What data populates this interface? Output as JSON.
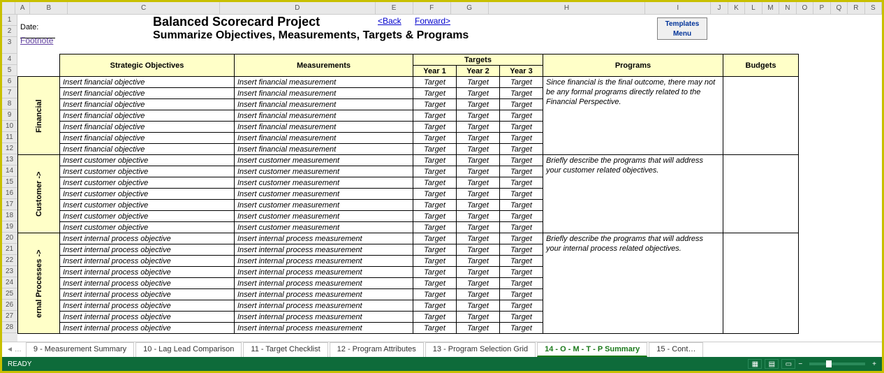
{
  "columns": [
    "A",
    "B",
    "C",
    "D",
    "E",
    "F",
    "G",
    "H",
    "I",
    "J",
    "K",
    "L",
    "M",
    "N",
    "O",
    "P",
    "Q",
    "R",
    "S"
  ],
  "rows": [
    "1",
    "2",
    "3",
    "4",
    "5",
    "6",
    "7",
    "8",
    "9",
    "10",
    "11",
    "12",
    "13",
    "14",
    "15",
    "16",
    "17",
    "18",
    "19",
    "20",
    "21",
    "22",
    "23",
    "24",
    "25",
    "26",
    "27",
    "28"
  ],
  "header": {
    "date_label": "Date:",
    "title1": "Balanced Scorecard Project",
    "title2": "Summarize Objectives, Measurements, Targets & Programs",
    "back": "<Back",
    "forward": "Forward>",
    "footnote": "Footnote",
    "templates_menu": "Templates Menu"
  },
  "table": {
    "hdr_objectives": "Strategic Objectives",
    "hdr_measurements": "Measurements",
    "hdr_targets": "Targets",
    "hdr_y1": "Year 1",
    "hdr_y2": "Year 2",
    "hdr_y3": "Year 3",
    "hdr_programs": "Programs",
    "hdr_budgets": "Budgets",
    "sections": [
      {
        "label": "Financial",
        "obj": "Insert financial objective",
        "meas": "Insert financial measurement",
        "tgt": "Target",
        "prog": "Since financial is the final outcome, there may not be any formal programs directly related to the Financial Perspective.",
        "rows": 7
      },
      {
        "label": "Customer ->",
        "obj": "Insert customer objective",
        "meas": "Insert customer measurement",
        "tgt": "Target",
        "prog": "Briefly describe the programs that will address your customer related objectives.",
        "rows": 7
      },
      {
        "label": "ernal Processes ->",
        "obj": "Insert internal process objective",
        "meas": "Insert internal process measurement",
        "tgt": "Target",
        "prog": "Briefly describe the programs that will address your internal process related objectives.",
        "rows": 9
      }
    ]
  },
  "tabs": {
    "nav_prev2": "◄",
    "nav_prev": "…",
    "items": [
      "9 - Measurement Summary",
      "10 - Lag Lead Comparison",
      "11 - Target Checklist",
      "12 - Program Attributes",
      "13 - Program Selection Grid",
      "14 - O - M - T - P Summary",
      "15 - Cont…"
    ],
    "active": 5
  },
  "status": {
    "ready": "READY"
  }
}
